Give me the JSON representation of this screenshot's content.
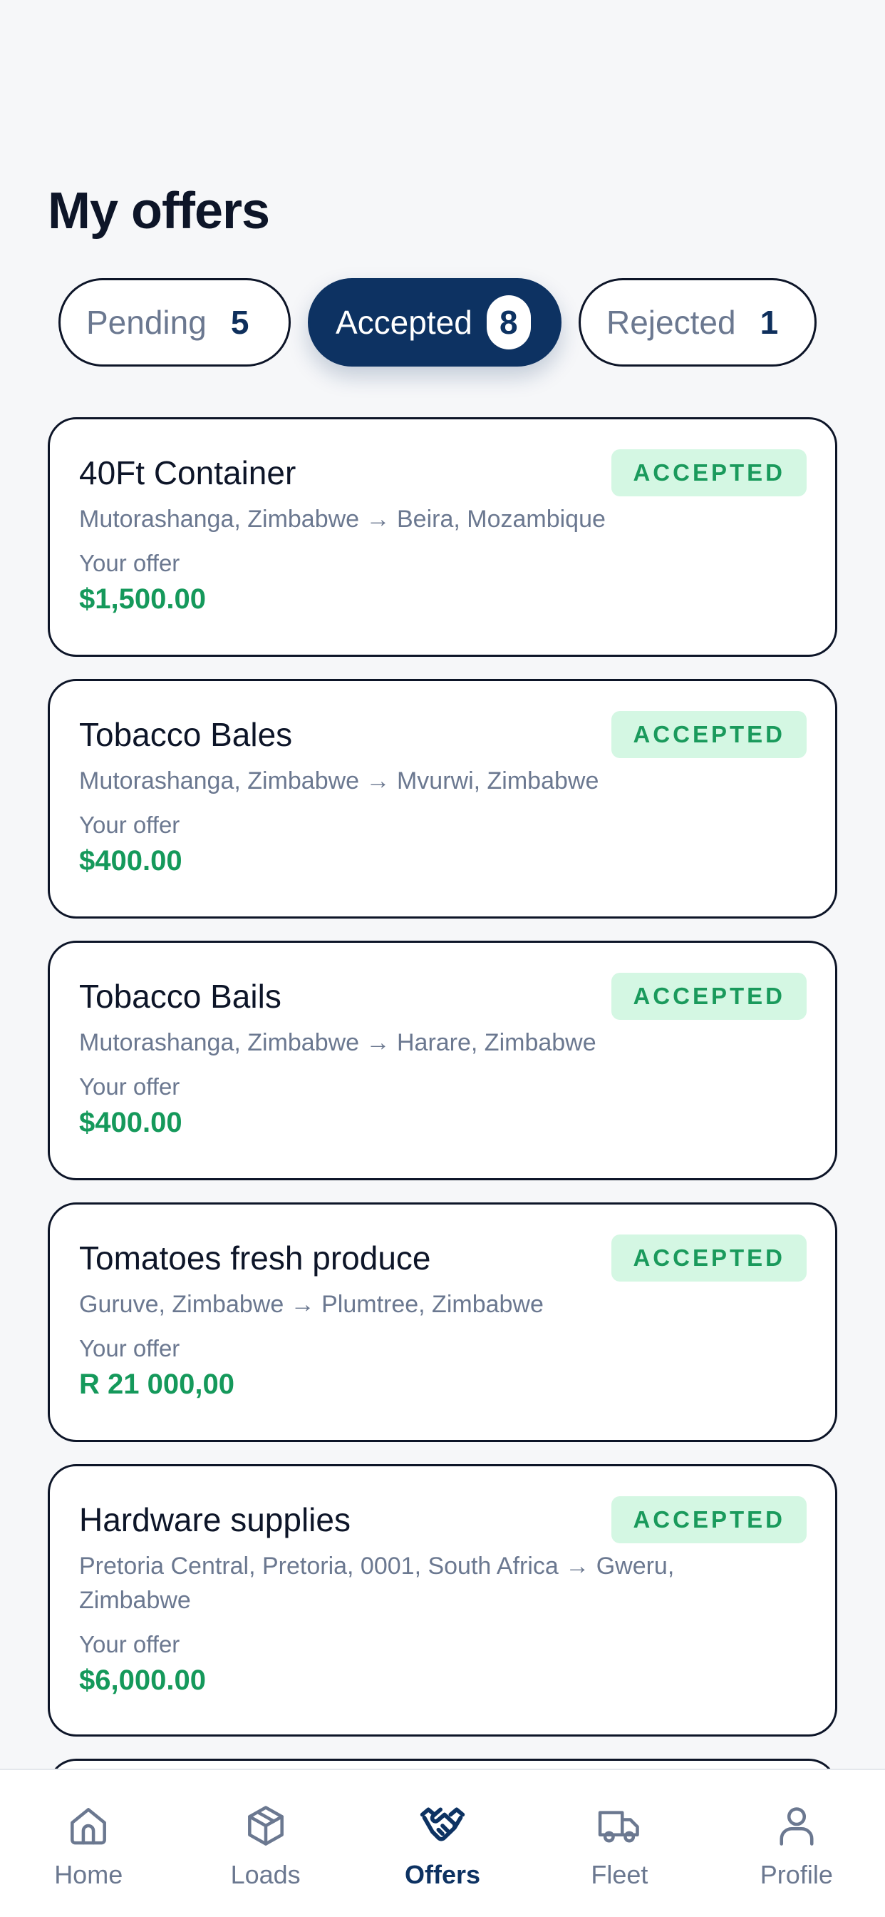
{
  "page": {
    "title": "My offers"
  },
  "tabs": [
    {
      "label": "Pending",
      "count": "5"
    },
    {
      "label": "Accepted",
      "count": "8"
    },
    {
      "label": "Rejected",
      "count": "1"
    }
  ],
  "offers": [
    {
      "title": "40Ft Container",
      "status": "ACCEPTED",
      "route": "Mutorashanga, Zimbabwe → Beira, Mozambique",
      "offer_label": "Your offer",
      "amount": "$1,500.00"
    },
    {
      "title": "Tobacco Bales",
      "status": "ACCEPTED",
      "route": "Mutorashanga, Zimbabwe → Mvurwi, Zimbabwe",
      "offer_label": "Your offer",
      "amount": "$400.00"
    },
    {
      "title": "Tobacco Bails",
      "status": "ACCEPTED",
      "route": "Mutorashanga, Zimbabwe → Harare, Zimbabwe",
      "offer_label": "Your offer",
      "amount": "$400.00"
    },
    {
      "title": "Tomatoes fresh produce",
      "status": "ACCEPTED",
      "route": "Guruve, Zimbabwe → Plumtree, Zimbabwe",
      "offer_label": "Your offer",
      "amount": "R 21 000,00"
    },
    {
      "title": "Hardware supplies",
      "status": "ACCEPTED",
      "route": "Pretoria Central, Pretoria, 0001, South Africa → Gweru, Zimbabwe",
      "offer_label": "Your offer",
      "amount": "$6,000.00"
    }
  ],
  "nav": [
    {
      "label": "Home",
      "icon": "home-icon"
    },
    {
      "label": "Loads",
      "icon": "box-icon"
    },
    {
      "label": "Offers",
      "icon": "handshake-icon",
      "active": true
    },
    {
      "label": "Fleet",
      "icon": "truck-icon"
    },
    {
      "label": "Profile",
      "icon": "user-icon"
    }
  ],
  "colors": {
    "primary": "#0d3262",
    "accent_green": "#15995b",
    "badge_bg": "#d4f7e3",
    "muted": "#6b7890"
  }
}
